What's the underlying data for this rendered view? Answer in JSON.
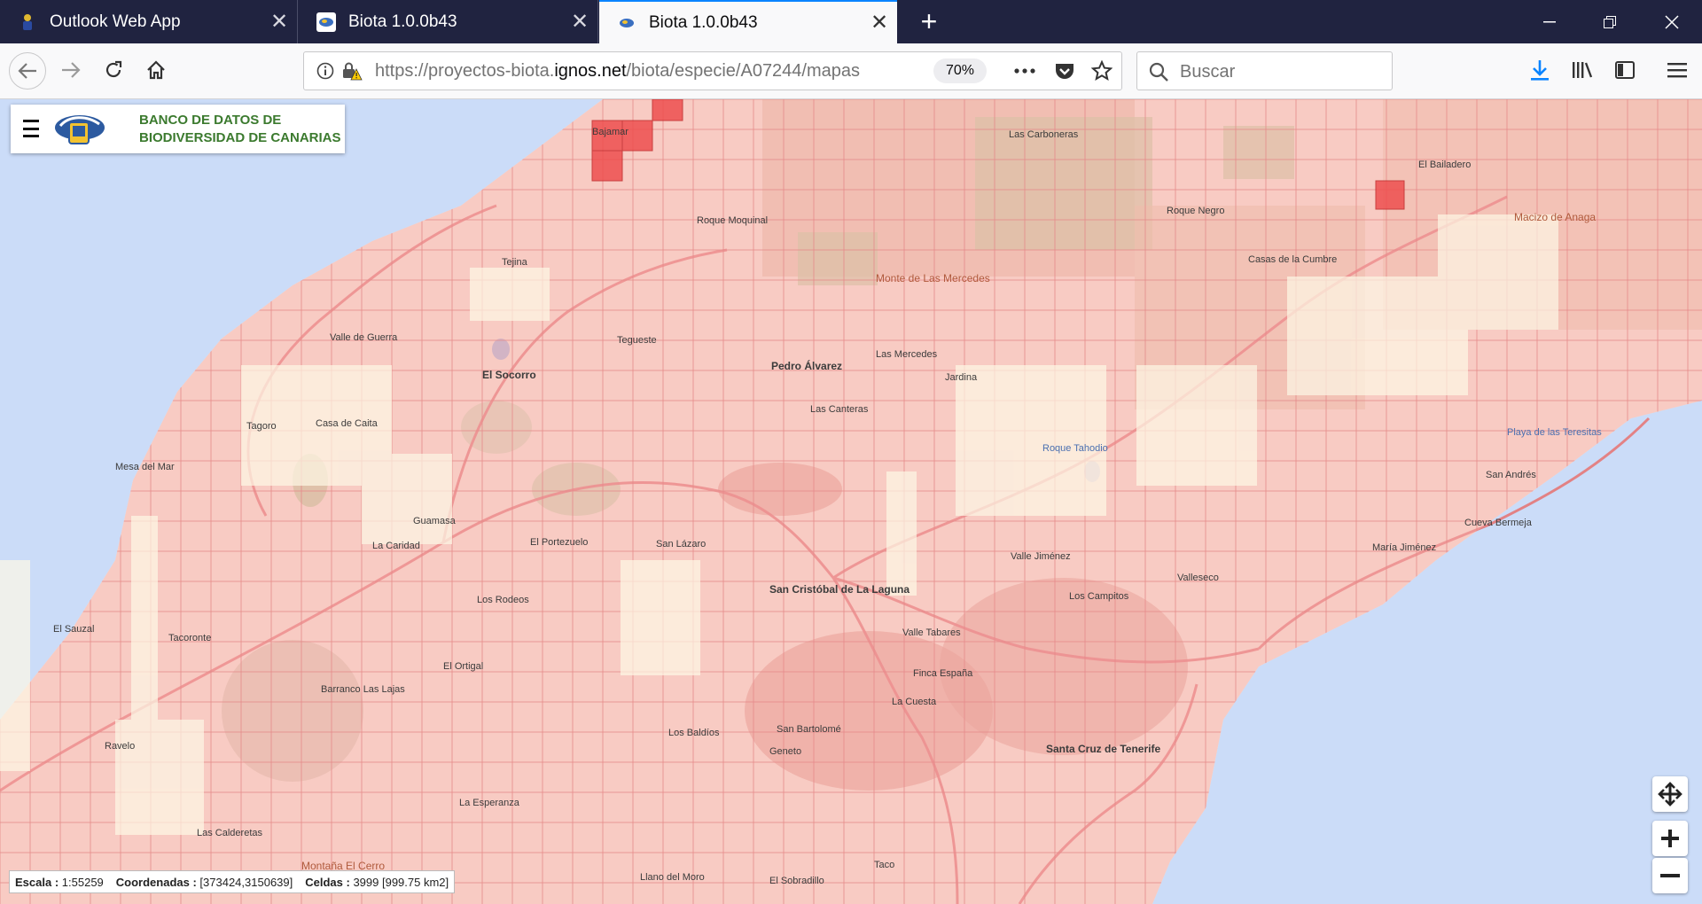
{
  "tabs": [
    {
      "title": "Outlook Web App",
      "active": false
    },
    {
      "title": "Biota 1.0.0b43",
      "active": false
    },
    {
      "title": "Biota 1.0.0b43",
      "active": true
    }
  ],
  "toolbar": {
    "url_prefix": "https://proyectos-biota.",
    "url_host": "ignos.net",
    "url_path": "/biota/especie/A07244/mapas",
    "zoom": "70%",
    "search_placeholder": "Buscar"
  },
  "app": {
    "title_line1": "BANCO DE DATOS DE",
    "title_line2": "BIODIVERSIDAD DE CANARIAS"
  },
  "map_labels": [
    {
      "text": "Bajamar",
      "style": ""
    },
    {
      "text": "Las Carboneras",
      "style": ""
    },
    {
      "text": "El Bailadero",
      "style": ""
    },
    {
      "text": "Macizo de Anaga",
      "style": "brown"
    },
    {
      "text": "Roque Negro",
      "style": ""
    },
    {
      "text": "Roque Moquinal",
      "style": ""
    },
    {
      "text": "Casas de la Cumbre",
      "style": ""
    },
    {
      "text": "Tejina",
      "style": ""
    },
    {
      "text": "Monte de Las Mercedes",
      "style": "brown"
    },
    {
      "text": "Valle de Guerra",
      "style": ""
    },
    {
      "text": "Tegueste",
      "style": ""
    },
    {
      "text": "Pedro Álvarez",
      "style": "b"
    },
    {
      "text": "Las Mercedes",
      "style": ""
    },
    {
      "text": "Jardina",
      "style": ""
    },
    {
      "text": "El Socorro",
      "style": "b"
    },
    {
      "text": "Las Canteras",
      "style": ""
    },
    {
      "text": "Tagoro",
      "style": ""
    },
    {
      "text": "Casa de Caita",
      "style": ""
    },
    {
      "text": "Mesa del Mar",
      "style": ""
    },
    {
      "text": "Roque Tahodio",
      "style": "blue"
    },
    {
      "text": "Playa de las Teresitas",
      "style": "blue"
    },
    {
      "text": "San Andrés",
      "style": ""
    },
    {
      "text": "Guamasa",
      "style": ""
    },
    {
      "text": "Cueva Bermeja",
      "style": ""
    },
    {
      "text": "La Caridad",
      "style": ""
    },
    {
      "text": "El Portezuelo",
      "style": ""
    },
    {
      "text": "San Lázaro",
      "style": ""
    },
    {
      "text": "María Jiménez",
      "style": ""
    },
    {
      "text": "Valle Jiménez",
      "style": ""
    },
    {
      "text": "Valleseco",
      "style": ""
    },
    {
      "text": "San Cristóbal de La Laguna",
      "style": "b"
    },
    {
      "text": "Los Rodeos",
      "style": ""
    },
    {
      "text": "Los Campitos",
      "style": ""
    },
    {
      "text": "El Sauzal",
      "style": ""
    },
    {
      "text": "Tacoronte",
      "style": ""
    },
    {
      "text": "Valle Tabares",
      "style": ""
    },
    {
      "text": "El Ortigal",
      "style": ""
    },
    {
      "text": "Finca España",
      "style": ""
    },
    {
      "text": "Barranco Las Lajas",
      "style": ""
    },
    {
      "text": "La Cuesta",
      "style": ""
    },
    {
      "text": "Los Baldíos",
      "style": ""
    },
    {
      "text": "San Bartolomé",
      "style": ""
    },
    {
      "text": "Geneto",
      "style": ""
    },
    {
      "text": "Santa Cruz de Tenerife",
      "style": "b"
    },
    {
      "text": "Ravelo",
      "style": ""
    },
    {
      "text": "La Esperanza",
      "style": ""
    },
    {
      "text": "Las Calderetas",
      "style": ""
    },
    {
      "text": "Montaña El Cerro",
      "style": "brown"
    },
    {
      "text": "Llano del Moro",
      "style": ""
    },
    {
      "text": "El Sobradillo",
      "style": ""
    },
    {
      "text": "Taco",
      "style": ""
    }
  ],
  "status": {
    "scale_label": "Escala :",
    "scale_value": "1:55259",
    "coords_label": "Coordenadas :",
    "coords_value": "[373424,3150639]",
    "cells_label": "Celdas :",
    "cells_value": "3999 [999.75 km2]"
  },
  "colors": {
    "accent": "#0a84ff",
    "tabbar": "#202340",
    "grid_fill": "#f4a6a6",
    "highlight": "#ee3333",
    "sea": "#cbdcf8",
    "land": "#fdf8e6",
    "brand_green": "#3b7a2e"
  }
}
